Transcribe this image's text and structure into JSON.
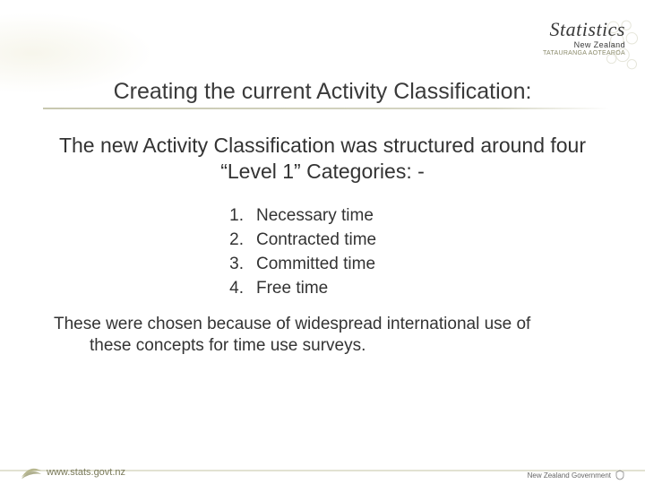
{
  "logo": {
    "brand": "Statistics",
    "sub": "New Zealand",
    "maori": "TATAURANGA AOTEAROA"
  },
  "title": "Creating the current Activity Classification:",
  "intro": "The new Activity Classification was structured around four “Level 1” Categories: -",
  "list": {
    "items": [
      {
        "num": "1.",
        "text": "Necessary time"
      },
      {
        "num": "2.",
        "text": "Contracted time"
      },
      {
        "num": "3.",
        "text": "Committed time"
      },
      {
        "num": "4.",
        "text": "Free time"
      }
    ]
  },
  "closing": {
    "line1": "These were chosen because of widespread international use of",
    "line2": "these concepts for time use surveys."
  },
  "footer": {
    "url": "www.stats.govt.nz",
    "govt_label": "New Zealand Government"
  }
}
